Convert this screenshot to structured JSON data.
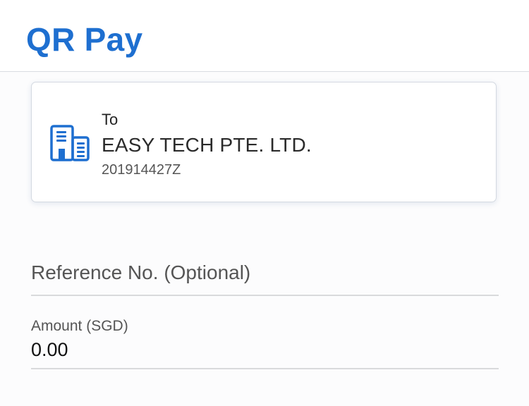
{
  "header": {
    "title": "QR Pay"
  },
  "payee": {
    "to_label": "To",
    "name": "EASY TECH PTE. LTD.",
    "uen": "201914427Z",
    "icon": "building-icon"
  },
  "form": {
    "reference": {
      "placeholder": "Reference No. (Optional)",
      "value": ""
    },
    "amount": {
      "label": "Amount (SGD)",
      "value": "0.00"
    }
  },
  "colors": {
    "brand": "#1e6fd0",
    "icon": "#1e6fd0",
    "divider": "#d9dadc"
  }
}
